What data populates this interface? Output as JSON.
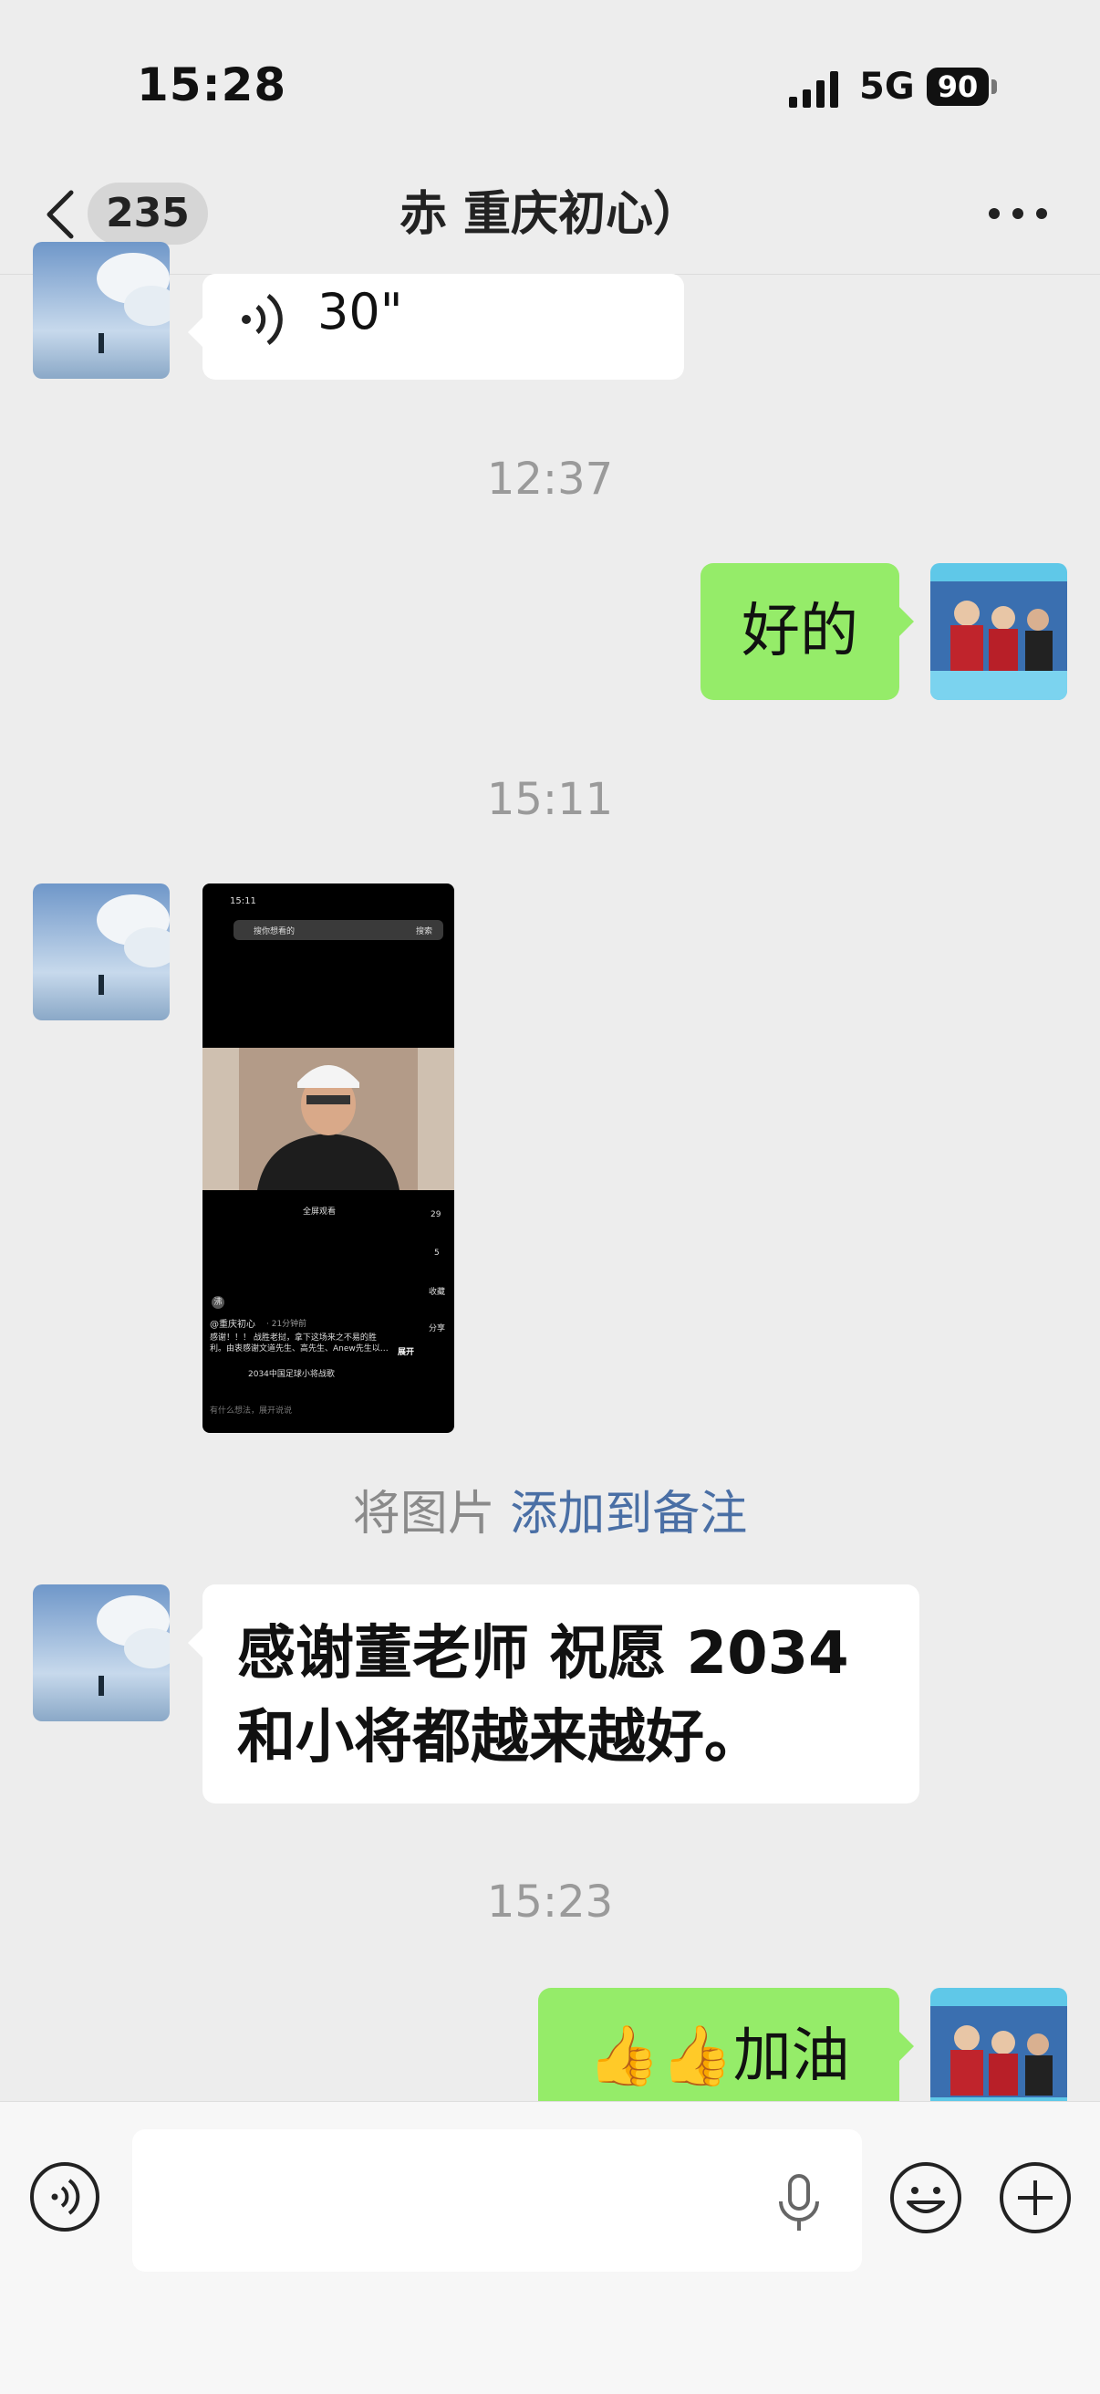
{
  "status_bar": {
    "time": "15:28",
    "network": "5G",
    "battery": "90"
  },
  "header": {
    "unread_count": "235",
    "title": "赤    重庆初心）"
  },
  "messages": {
    "voice": {
      "duration": "30\""
    },
    "ts1": "12:37",
    "reply_ok": "好的",
    "ts2": "15:11",
    "screenshot": {
      "time": "15:11",
      "search_placeholder": "搜你想看的",
      "search_button": "搜索",
      "account": "@重庆初心",
      "posted": "· 21分钟前",
      "caption": "感谢！！！ 战胜老挝，拿下这场来之不易的胜利。由衷感谢文道先生、高先生、Anew先生以…",
      "expand": "展开",
      "music_tag": "2034中国足球小将战歌",
      "fullscreen": "全屏观看",
      "likes": "29",
      "comments": "5",
      "favorite": "收藏",
      "share": "分享",
      "comment_placeholder": "有什么想法，展开说说",
      "avatar_label": "沸"
    },
    "note_prompt": {
      "prefix": "将图片",
      "link": "添加到备注"
    },
    "thanks": "感谢董老师 祝愿 2034 和小将都越来越好。",
    "ts3": "15:23",
    "cheer": "👍👍加油"
  },
  "colors": {
    "background": "#ededed",
    "bubble_mine": "#95ec69",
    "bubble_theirs": "#ffffff",
    "link": "#4a6fa5",
    "timestamp": "#9a9a9a"
  },
  "icons": [
    "back-icon",
    "more-icon",
    "voice-play-icon",
    "voice-toggle-icon",
    "mic-icon",
    "emoji-icon",
    "plus-icon",
    "signal-icon",
    "battery-icon"
  ]
}
